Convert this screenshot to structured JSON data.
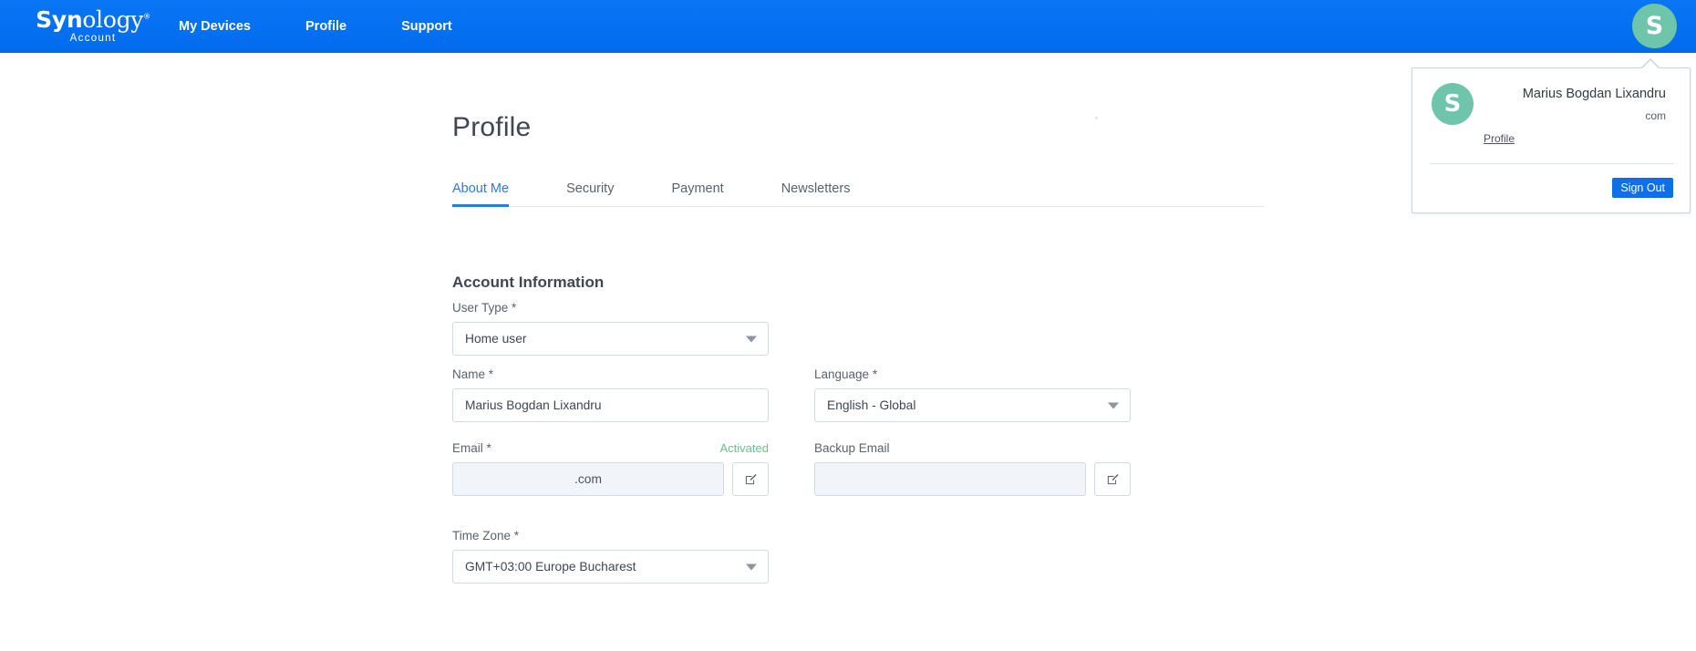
{
  "brand": {
    "name_bold": "Syn",
    "name_light": "ology",
    "registered": "®",
    "subtitle": "Account"
  },
  "header": {
    "nav": [
      {
        "label": "My Devices",
        "name": "nav-my-devices"
      },
      {
        "label": "Profile",
        "name": "nav-profile"
      },
      {
        "label": "Support",
        "name": "nav-support"
      }
    ],
    "avatar_initial": "S",
    "avatar_color": "#6ec5a9",
    "bar_color": "#0071f2"
  },
  "user_menu": {
    "avatar_initial": "S",
    "name": "Marius Bogdan Lixandru",
    "email": "com",
    "profile_link": "Profile",
    "sign_out": "Sign Out",
    "sign_out_color": "#0f6fe8"
  },
  "page": {
    "title": "Profile",
    "tabs": [
      {
        "label": "About Me",
        "active": true
      },
      {
        "label": "Security",
        "active": false
      },
      {
        "label": "Payment",
        "active": false
      },
      {
        "label": "Newsletters",
        "active": false
      }
    ],
    "active_tab_color": "#2a7ae2",
    "section_title": "Account Information"
  },
  "form": {
    "user_type": {
      "label": "User Type *",
      "value": "Home user"
    },
    "name": {
      "label": "Name *",
      "value": "Marius Bogdan Lixandru",
      "placeholder": "Name"
    },
    "language": {
      "label": "Language *",
      "value": "English - Global"
    },
    "email": {
      "label": "Email *",
      "status": "Activated",
      "status_color": "#63c48a",
      "value": ".com",
      "edit_icon": "pencil-square-icon"
    },
    "backup_email": {
      "label": "Backup Email",
      "value": "",
      "placeholder": "",
      "edit_icon": "pencil-square-icon"
    },
    "time_zone": {
      "label": "Time Zone *",
      "value": "GMT+03:00 Europe Bucharest"
    }
  }
}
